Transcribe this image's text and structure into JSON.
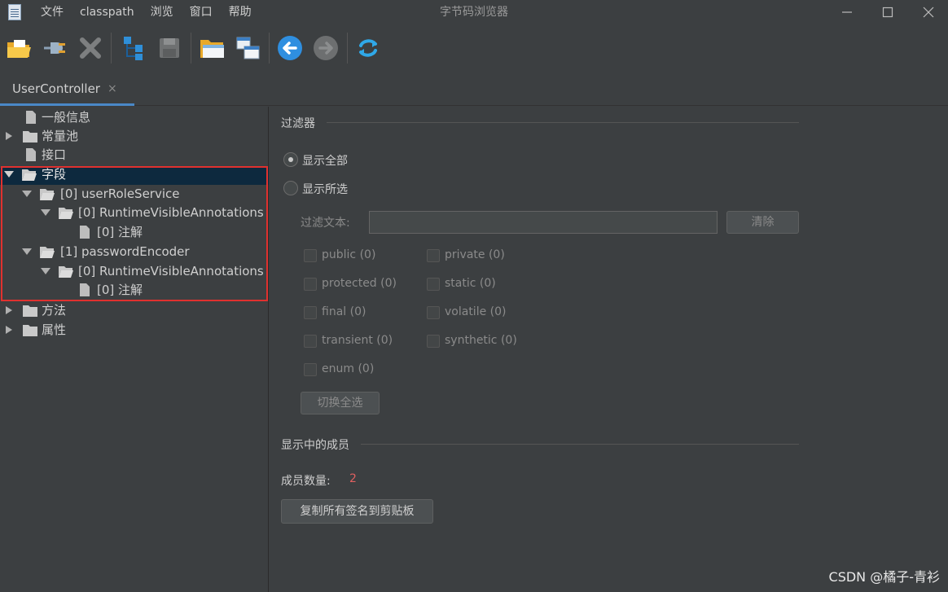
{
  "window": {
    "title": "字节码浏览器",
    "menu": [
      "文件",
      "classpath",
      "浏览",
      "窗口",
      "帮助"
    ]
  },
  "toolbar": {
    "icons": [
      "open-folder-icon",
      "plug-icon",
      "delete-icon",
      "tree-structure-icon",
      "save-icon",
      "folder-open-icon",
      "window-icon",
      "back-arrow-icon",
      "forward-arrow-icon",
      "refresh-icon"
    ]
  },
  "tab": {
    "label": "UserController",
    "close": "×"
  },
  "tree": {
    "items": [
      {
        "label": "一般信息"
      },
      {
        "label": "常量池"
      },
      {
        "label": "接口"
      },
      {
        "label": "字段"
      },
      {
        "label": "[0] userRoleService"
      },
      {
        "label": "[0] RuntimeVisibleAnnotations"
      },
      {
        "label": "[0] 注解"
      },
      {
        "label": "[1] passwordEncoder"
      },
      {
        "label": "[0] RuntimeVisibleAnnotations"
      },
      {
        "label": "[0] 注解"
      },
      {
        "label": "方法"
      },
      {
        "label": "属性"
      }
    ]
  },
  "filter": {
    "title": "过滤器",
    "show_all": "显示全部",
    "show_selected": "显示所选",
    "filter_text_label": "过滤文本:",
    "filter_text_value": "",
    "clear_button": "清除",
    "checkboxes": [
      "public (0)",
      "private (0)",
      "protected (0)",
      "static (0)",
      "final (0)",
      "volatile (0)",
      "transient (0)",
      "synthetic (0)",
      "enum (0)"
    ],
    "toggle_all_button": "切换全选"
  },
  "members": {
    "title": "显示中的成员",
    "count_label": "成员数量:",
    "count_value": "2",
    "copy_button": "复制所有签名到剪贴板"
  },
  "watermark": "CSDN @橘子-青衫",
  "colors": {
    "background": "#3c3f41",
    "selection": "#0d293e",
    "highlight_box": "#e0312f",
    "tab_accent": "#4a88c7",
    "count": "#e06060"
  }
}
